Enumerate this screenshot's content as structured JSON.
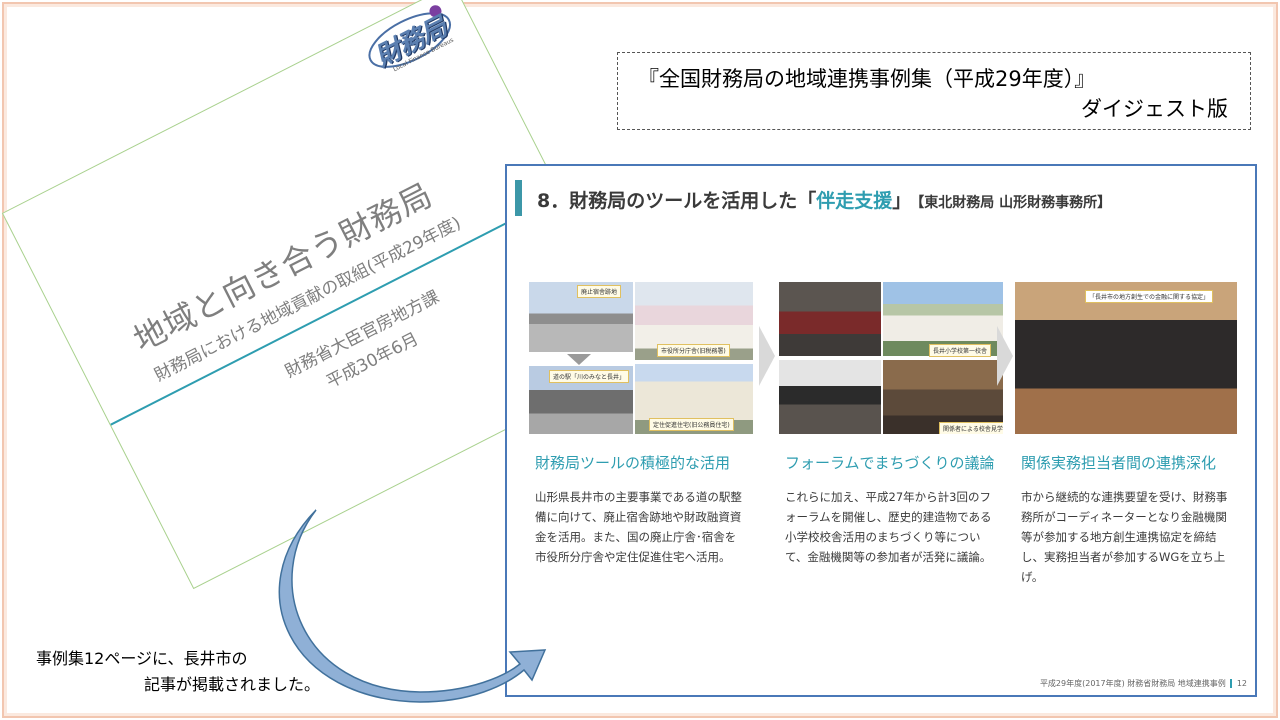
{
  "cover": {
    "logo_text": "財務局",
    "logo_sub": "Local Finance Bureaus",
    "title": "地域と向き合う財務局",
    "subtitle": "財務局における地域貢献の取組(平成29年度)",
    "org": "財務省大臣官房地方課",
    "date": "平成30年6月"
  },
  "digest": {
    "line1": "『全国財務局の地域連携事例集（平成29年度）』",
    "line2": "ダイジェスト版"
  },
  "case": {
    "heading_prefix": "8．財務局のツールを活用した「",
    "heading_highlight": "伴走支援",
    "heading_suffix": "」",
    "heading_bureau": "【東北財務局 山形財務事務所】",
    "columns": [
      {
        "title": "財務局ツールの積極的な活用",
        "text": "山形県長井市の主要事業である道の駅整備に向けて、廃止宿舎跡地や財政融資資金を活用。また、国の廃止庁舎･宿舎を市役所分庁舎や定住促進住宅へ活用。",
        "tags": [
          "廃止宿舎跡地",
          "市役所分庁舎(旧税務署)",
          "道の駅「川のみなと長井」",
          "定住促進住宅(旧公務員住宅)"
        ]
      },
      {
        "title": "フォーラムでまちづくりの議論",
        "text": "これらに加え、平成27年から計3回のフォーラムを開催し、歴史的建造物である小学校校舎活用のまちづくり等について、金融機関等の参加者が活発に議論。",
        "tags": [
          "長井小学校第一校舎",
          "関係者による校舎見学"
        ]
      },
      {
        "title": "関係実務担当者間の連携深化",
        "text": "市から継続的な連携要望を受け、財務事務所がコーディネーターとなり金融機関等が参加する地方創生連携協定を締結し、実務担当者が参加するWGを立ち上げ。",
        "tags": [
          "「長井市の地方創生での金融に関する協定」"
        ]
      }
    ],
    "footer": "平成29年度(2017年度) 財務省財務局 地域連携事例",
    "page": "12"
  },
  "caption": {
    "line1": "事例集12ページに、長井市の",
    "line2": "記事が掲載されました。"
  }
}
